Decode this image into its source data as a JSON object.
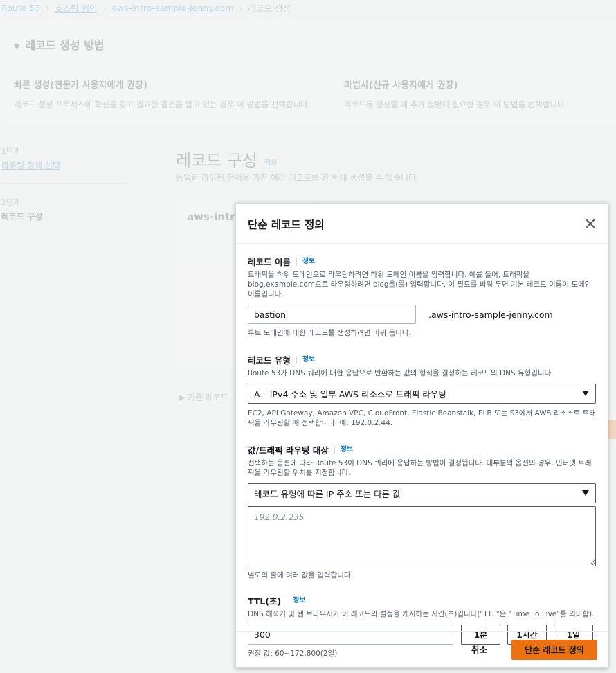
{
  "breadcrumb": {
    "items": [
      "Route 53",
      "호스팅 영역",
      "aws-intro-sample-jenny.com"
    ],
    "current": "레코드 생성"
  },
  "method": {
    "title": "레코드 생성 방법",
    "quick_title": "빠른 생성(전문가 사용자에게 권장)",
    "quick_desc": "레코드 생성 프로세스에 확신을 갖고 필요한 옵션을 알고 있는 경우 이 방법을 선택합니다.",
    "wizard_title": "마법사(신규 사용자에게 권장)",
    "wizard_desc": "레코드를 생성할 때 추가 설명이 필요한 경우 이 방법을 선택합니다."
  },
  "steps": [
    {
      "number": "1단계",
      "label": "라우팅 정책 선택"
    },
    {
      "number": "2단계",
      "label": "레코드 구성"
    }
  ],
  "config": {
    "title": "레코드 구성",
    "info": "정보",
    "subtitle": "동일한 라우팅 정책을 가진 여러 레코드를 한 번에 생성할 수 있습니다.",
    "card_title": "aws-intro",
    "basic_records": "기존 레코드"
  },
  "modal": {
    "title": "단순 레코드 정의",
    "record_name": {
      "label": "레코드 이름",
      "info": "정보",
      "desc": "트래픽을 하위 도메인으로 라우팅하려면 하위 도메인 이름을 입력합니다. 예를 들어, 트래픽을 blog.example.com으로 라우팅하려면 blog을(를) 입력합니다. 이 필드를 비워 두면 기본 레코드 이름이 도메인 이름입니다.",
      "value": "bastion",
      "suffix": ".aws-intro-sample-jenny.com",
      "constraint": "루트 도메인에 대한 레코드를 생성하려면 비워 둡니다."
    },
    "record_type": {
      "label": "레코드 유형",
      "info": "정보",
      "desc": "Route 53가 DNS 쿼리에 대한 응답으로 반환하는 값의 형식을 결정하는 레코드의 DNS 유형입니다.",
      "selected": "A – IPv4 주소 및 일부 AWS 리소스로 트래픽 라우팅",
      "hint": "EC2, API Gateway, Amazon VPC, CloudFront, Elastic Beanstalk, ELB 또는 S3에서 AWS 리소스로 트래픽을 라우팅할 때 선택합니다. 예: 192.0.2.44."
    },
    "value": {
      "label": "값/트래픽 라우팅 대상",
      "info": "정보",
      "desc": "선택하는 옵션에 따라 Route 53이 DNS 쿼리에 응답하는 방법이 결정됩니다. 대부분의 옵션의 경우, 인터넷 트래픽을 라우팅할 위치를 지정합니다.",
      "selected": "레코드 유형에 따른 IP 주소 또는 다른 값",
      "placeholder": "192.0.2.235",
      "constraint": "별도의 줄에 여러 값을 입력합니다."
    },
    "ttl": {
      "label": "TTL(초)",
      "info": "정보",
      "desc": "DNS 해석기 및 웹 브라우저가 이 레코드의 설정을 캐시하는 시간(초)입니다(\"TTL\"은 \"Time To Live\"를 의미함).",
      "value": "300",
      "btn_1m": "1분",
      "btn_1h": "1시간",
      "btn_1d": "1일",
      "constraint": "권장 값: 60~172,800(2일)"
    },
    "cancel_label": "취소",
    "submit_label": "단순 레코드 정의"
  },
  "colors": {
    "accent": "#ec7211",
    "link": "#0073bb"
  },
  "icons": {
    "close": "close-icon",
    "caret": "caret-down-icon"
  }
}
